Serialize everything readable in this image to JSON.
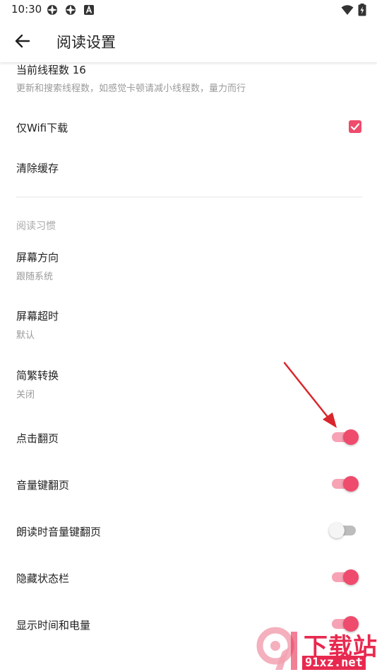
{
  "status_bar": {
    "time": "10:30",
    "icons": [
      "settings-icon",
      "settings-icon",
      "notification-a-icon",
      "wifi-icon",
      "battery-icon"
    ]
  },
  "app_bar": {
    "title": "阅读设置",
    "back_icon": "arrow-left-icon"
  },
  "prefs": {
    "threads": {
      "title": "当前线程数 16",
      "summary": "更新和搜索线程数，如感觉卡顿请减小线程数，量力而行"
    },
    "wifi_only": {
      "title": "仅Wifi下载",
      "checked": true
    },
    "clear_cache": {
      "title": "清除缓存"
    },
    "category": {
      "title": "阅读习惯"
    },
    "orientation": {
      "title": "屏幕方向",
      "summary": "跟随系统"
    },
    "timeout": {
      "title": "屏幕超时",
      "summary": "默认"
    },
    "chinese": {
      "title": "简繁转换",
      "summary": "关闭"
    },
    "click_turn": {
      "title": "点击翻页",
      "on": true
    },
    "volume_turn": {
      "title": "音量键翻页",
      "on": true
    },
    "read_aloud_volume": {
      "title": "朗读时音量键翻页",
      "on": false
    },
    "hide_status": {
      "title": "隐藏状态栏",
      "on": true
    },
    "show_time": {
      "title": "显示时间和电量",
      "on": true
    }
  },
  "colors": {
    "accent": "#ef4b6c",
    "arrow": "#d9262c",
    "watermark": "#e8294f"
  },
  "watermark": {
    "text_top": "下载站",
    "text_bottom": "91xz.net"
  }
}
